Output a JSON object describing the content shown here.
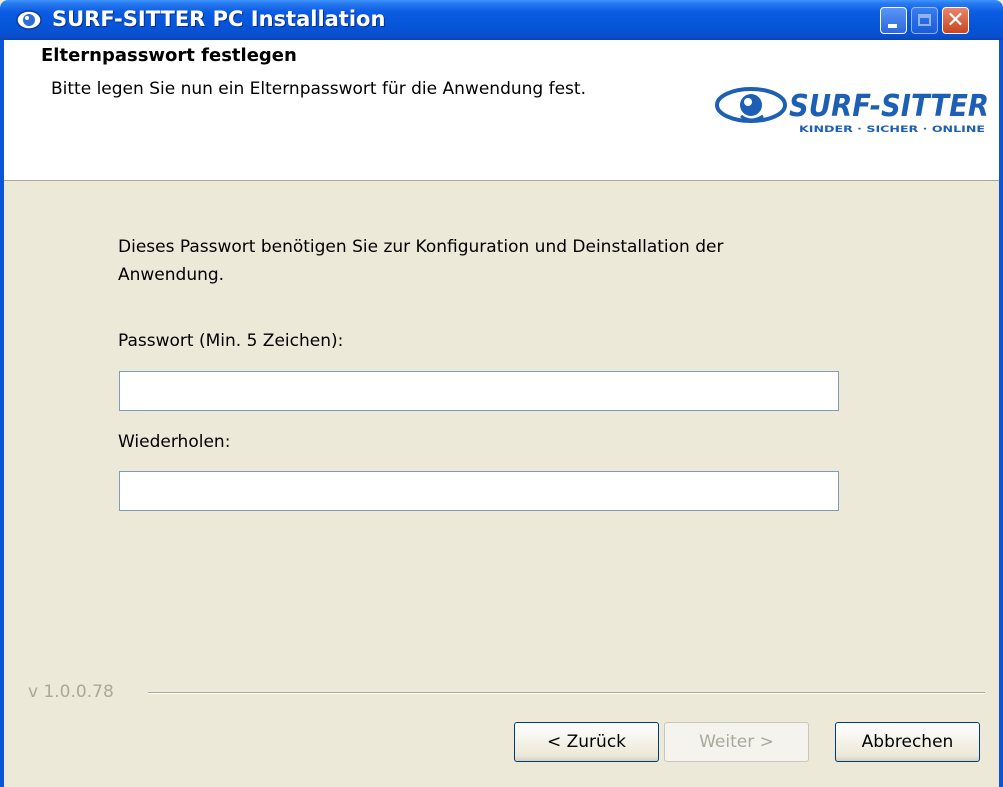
{
  "window": {
    "title": "SURF-SITTER PC Installation",
    "icon": "surf-sitter-app-icon"
  },
  "header": {
    "title": "Elternpasswort festlegen",
    "subtitle": "Bitte legen Sie nun ein Elternpasswort für die Anwendung fest.",
    "logo_text": "SURF-SITTER",
    "logo_tagline": "KINDER · SICHER · ONLINE"
  },
  "main": {
    "description": "Dieses Passwort benötigen Sie zur Konfiguration und Deinstallation der Anwendung.",
    "password_label": "Passwort (Min. 5 Zeichen):",
    "password_value": "",
    "repeat_label": "Wiederholen:",
    "repeat_value": ""
  },
  "footer": {
    "version": "v 1.0.0.78",
    "back_label": "< Zurück",
    "next_label": "Weiter >",
    "cancel_label": "Abbrechen"
  },
  "colors": {
    "titlebar": "#0a5ce3",
    "dialog_bg": "#ece9d8",
    "logo_blue": "#1d5fb5"
  }
}
